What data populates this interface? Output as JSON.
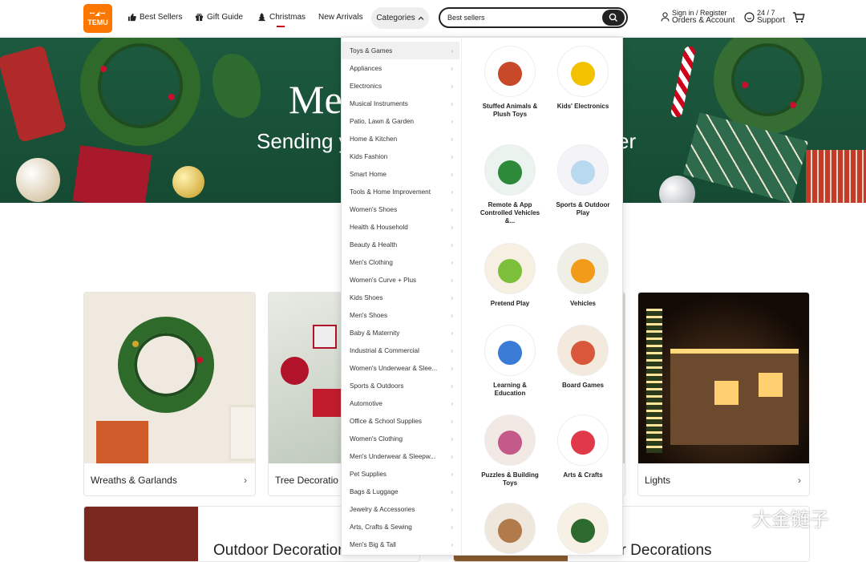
{
  "header": {
    "logo_top": "ꟷ◢ꟷ",
    "logo_bottom": "TEMU",
    "nav": [
      "Best Sellers",
      "Gift Guide",
      "Christmas",
      "New Arrivals"
    ],
    "categories_label": "Categories",
    "search_value": "Best sellers",
    "account_line1": "Sign in / Register",
    "account_line2": "Orders & Account",
    "support_line1": "24 / 7",
    "support_line2": "Support"
  },
  "banner": {
    "title": "Me",
    "subtitle": "Sending y",
    "subtitle_end": "er"
  },
  "menu": {
    "categories": [
      "Toys & Games",
      "Appliances",
      "Electronics",
      "Musical Instruments",
      "Patio, Lawn & Garden",
      "Home & Kitchen",
      "Kids Fashion",
      "Smart Home",
      "Tools & Home Improvement",
      "Women's Shoes",
      "Health & Household",
      "Beauty & Health",
      "Men's Clothing",
      "Women's Curve + Plus",
      "Kids Shoes",
      "Men's Shoes",
      "Baby & Maternity",
      "Industrial & Commercial",
      "Women's Underwear & Slee...",
      "Sports & Outdoors",
      "Automotive",
      "Office & School Supplies",
      "Women's Clothing",
      "Men's Underwear & Sleepw...",
      "Pet Supplies",
      "Bags & Luggage",
      "Jewelry & Accessories",
      "Arts, Crafts & Sewing",
      "Men's Big & Tall"
    ],
    "subcategories": [
      {
        "name": "Stuffed Animals & Plush Toys"
      },
      {
        "name": "Kids' Electronics"
      },
      {
        "name": "Remote & App Controlled Vehicles &..."
      },
      {
        "name": "Sports & Outdoor Play"
      },
      {
        "name": "Pretend Play"
      },
      {
        "name": "Vehicles"
      },
      {
        "name": "Learning & Education"
      },
      {
        "name": "Board Games"
      },
      {
        "name": "Puzzles & Building Toys"
      },
      {
        "name": "Arts & Crafts"
      },
      {
        "name": ""
      },
      {
        "name": ""
      }
    ]
  },
  "cards": [
    {
      "label": "Wreaths & Garlands"
    },
    {
      "label": "Tree Decoratio"
    },
    {
      "label": ""
    },
    {
      "label": "Lights"
    }
  ],
  "bottom": {
    "outdoor": "Outdoor Decorations",
    "indoor": "Indoor Decorations"
  },
  "watermark": "大金链子",
  "colors": {
    "brand": "#fb7701",
    "banner_green": "#1c5a3f",
    "christmas_red": "#d0021b"
  }
}
